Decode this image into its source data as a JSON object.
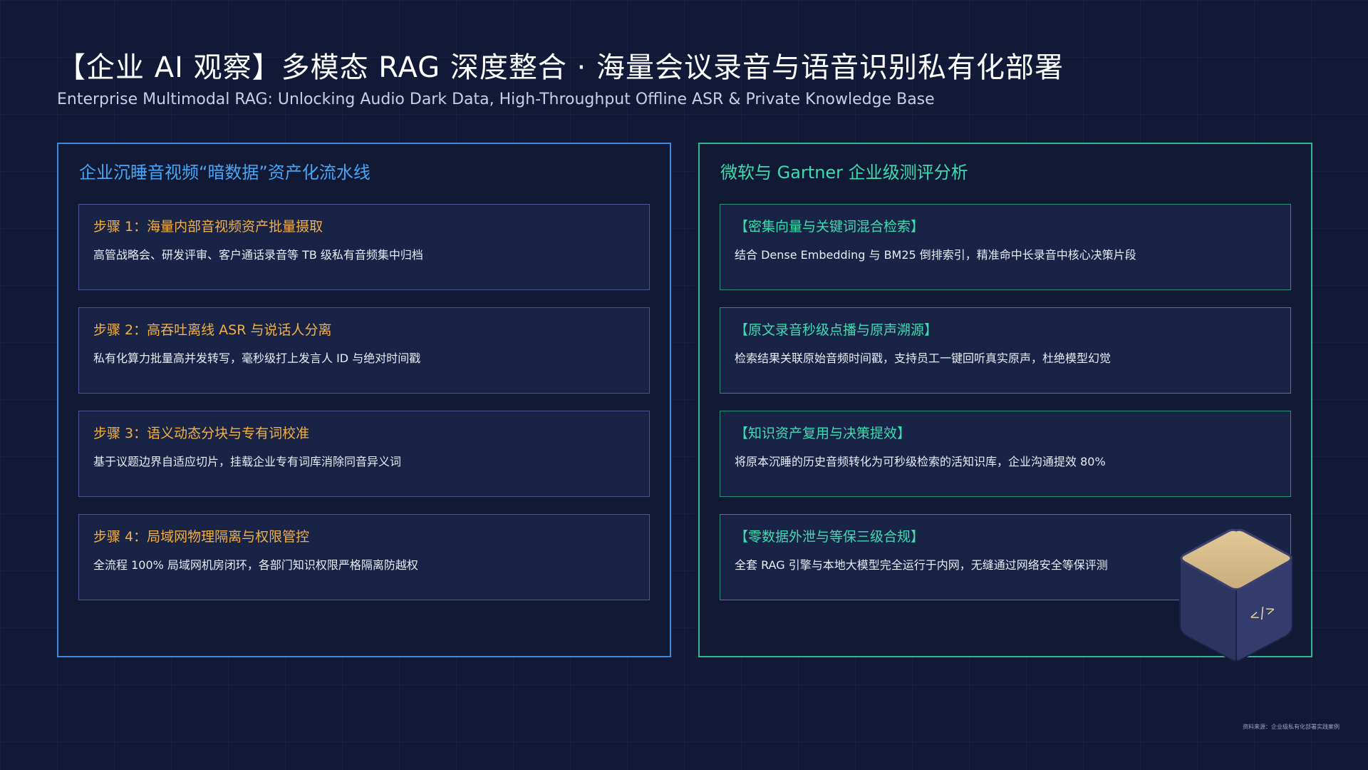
{
  "header": {
    "title": "【企业 AI 观察】多模态 RAG 深度整合 ·  海量会议录音与语音识别私有化部署",
    "subtitle": "Enterprise Multimodal RAG: Unlocking Audio Dark Data, High-Throughput Offline ASR & Private Knowledge Base"
  },
  "left_panel": {
    "title": "企业沉睡音视频“暗数据”资产化流水线",
    "cards": [
      {
        "heading": "步骤 1：海量内部音视频资产批量摄取",
        "desc": "高管战略会、研发评审、客户通话录音等 TB 级私有音频集中归档"
      },
      {
        "heading": "步骤 2：高吞吐离线 ASR 与说话人分离",
        "desc": "私有化算力批量高并发转写，毫秒级打上发言人 ID 与绝对时间戳"
      },
      {
        "heading": "步骤 3：语义动态分块与专有词校准",
        "desc": "基于议题边界自适应切片，挂载企业专有词库消除同音异义词"
      },
      {
        "heading": "步骤 4：局域网物理隔离与权限管控",
        "desc": "全流程 100% 局域网机房闭环，各部门知识权限严格隔离防越权"
      }
    ]
  },
  "right_panel": {
    "title": "微软与 Gartner 企业级测评分析",
    "cards": [
      {
        "heading": "【密集向量与关键词混合检索】",
        "desc": "结合 Dense Embedding 与 BM25 倒排索引，精准命中长录音中核心决策片段"
      },
      {
        "heading": "【原文录音秒级点播与原声溯源】",
        "desc": "检索结果关联原始音频时间戳，支持员工一键回听真实原声，杜绝模型幻觉"
      },
      {
        "heading": "【知识资产复用与决策提效】",
        "desc": "将原本沉睡的历史音频转化为可秒级检索的活知识库，企业沟通提效 80%"
      },
      {
        "heading": "【零数据外泄与等保三级合规】",
        "desc": "全套 RAG 引擎与本地大模型完全运行于内网，无缝通过网络安全等保评测"
      }
    ]
  },
  "decoration": {
    "cube_icon": "code-cube-icon",
    "cube_symbol": "</>"
  },
  "footer": {
    "note": "资料来源：企业级私有化部署实践案例"
  },
  "colors": {
    "background": "#111936",
    "left_accent": "#3f8ae0",
    "right_accent": "#2fb890",
    "step_heading": "#f1b046",
    "right_heading": "#3ddcb0"
  }
}
